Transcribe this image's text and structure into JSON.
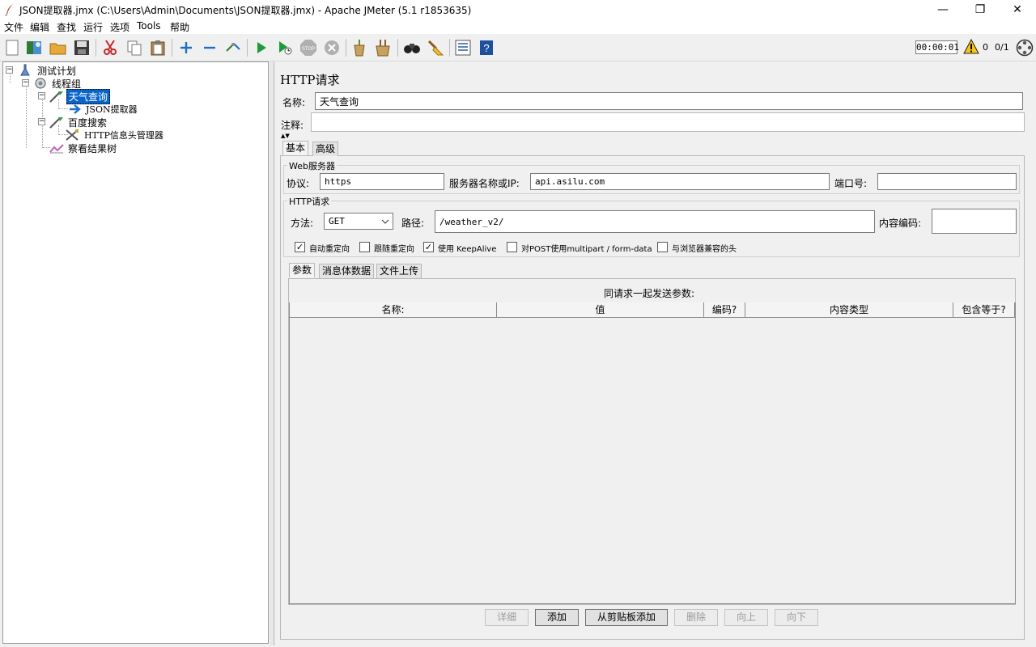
{
  "window": {
    "title": "JSON提取器.jmx (C:\\Users\\Admin\\Documents\\JSON提取器.jmx) - Apache JMeter (5.1 r1853635)",
    "minimize_glyph": "—",
    "restore_glyph": "❐",
    "close_glyph": "✕"
  },
  "menu": {
    "items": [
      "文件",
      "编辑",
      "查找",
      "运行",
      "选项",
      "Tools",
      "帮助"
    ]
  },
  "toolbar": {
    "icons": [
      "new-icon",
      "templates-icon",
      "open-icon",
      "save-icon",
      "cut-icon",
      "copy-icon",
      "paste-icon",
      "expand-icon",
      "collapse-icon",
      "toggle-icon",
      "start-icon",
      "start-no-pause-icon",
      "stop-icon",
      "shutdown-icon",
      "clear-icon",
      "clear-all-icon",
      "search-icon",
      "reset-search-icon",
      "function-helper-icon",
      "help-icon"
    ],
    "timer": "00:00:01",
    "warning_count": "0",
    "thread_count": "0/1"
  },
  "tree": {
    "nodes": [
      {
        "label": "测试计划",
        "icon": "test-plan-icon"
      },
      {
        "label": "线程组",
        "icon": "thread-group-icon"
      },
      {
        "label": "天气查询",
        "icon": "sampler-icon",
        "selected": true
      },
      {
        "label": "JSON提取器",
        "icon": "extractor-icon"
      },
      {
        "label": "百度搜索",
        "icon": "sampler-icon"
      },
      {
        "label": "HTTP信息头管理器",
        "icon": "config-icon"
      },
      {
        "label": "察看结果树",
        "icon": "listener-icon"
      }
    ]
  },
  "panel": {
    "title": "HTTP请求",
    "name_label": "名称:",
    "name_value": "天气查询",
    "comment_label": "注释:",
    "comment_value": "",
    "tabs": [
      "基本",
      "高级"
    ],
    "web_server": {
      "group_title": "Web服务器",
      "protocol_label": "协议:",
      "protocol_value": "https",
      "server_label": "服务器名称或IP:",
      "server_value": "api.asilu.com",
      "port_label": "端口号:",
      "port_value": ""
    },
    "http_request": {
      "group_title": "HTTP请求",
      "method_label": "方法:",
      "method_value": "GET",
      "path_label": "路径:",
      "path_value": "/weather_v2/",
      "encoding_label": "内容编码:",
      "encoding_value": ""
    },
    "options": [
      {
        "label": "自动重定向",
        "checked": true
      },
      {
        "label": "跟随重定向",
        "checked": false
      },
      {
        "label": "使用 KeepAlive",
        "checked": true
      },
      {
        "label": "对POST使用multipart / form-data",
        "checked": false
      },
      {
        "label": "与浏览器兼容的头",
        "checked": false
      }
    ],
    "sub_tabs": [
      "参数",
      "消息体数据",
      "文件上传"
    ],
    "params_caption": "同请求一起发送参数:",
    "columns": [
      "名称:",
      "值",
      "编码?",
      "内容类型",
      "包含等于?"
    ],
    "buttons": [
      {
        "label": "详细",
        "enabled": false
      },
      {
        "label": "添加",
        "enabled": true
      },
      {
        "label": "从剪贴板添加",
        "enabled": true
      },
      {
        "label": "删除",
        "enabled": false
      },
      {
        "label": "向上",
        "enabled": false
      },
      {
        "label": "向下",
        "enabled": false
      }
    ]
  }
}
